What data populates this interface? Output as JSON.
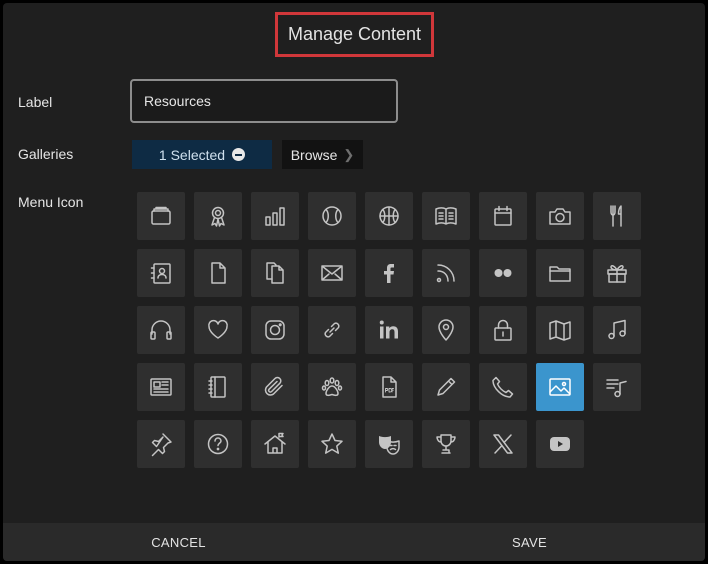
{
  "dialog": {
    "title": "Manage Content"
  },
  "fields": {
    "label": {
      "label": "Label",
      "value": "Resources"
    },
    "galleries": {
      "label": "Galleries",
      "selected_label": "1 Selected",
      "browse_label": "Browse"
    },
    "menu_icon": {
      "label": "Menu Icon"
    }
  },
  "icons": [
    [
      "wallet",
      "award",
      "bar-chart",
      "baseball",
      "basketball",
      "book",
      "calendar",
      "camera",
      "cutlery"
    ],
    [
      "contact-card",
      "document",
      "documents",
      "mail",
      "facebook",
      "rss",
      "flickr",
      "folder",
      "gift"
    ],
    [
      "headphones",
      "heart",
      "instagram",
      "link",
      "linkedin",
      "map-pin",
      "lock",
      "map",
      "music"
    ],
    [
      "newspaper",
      "notebook",
      "paperclip",
      "paw",
      "pdf",
      "pencil",
      "phone",
      "image",
      "playlist"
    ],
    [
      "pushpin",
      "question",
      "house-flag",
      "star",
      "theater-masks",
      "trophy",
      "x-logo",
      "youtube"
    ]
  ],
  "selected_icon": "image",
  "colors": {
    "accent": "#3b95cd",
    "highlight_border": "#d0373a",
    "selected_pill": "#0e2b44"
  },
  "footer": {
    "cancel_label": "CANCEL",
    "save_label": "SAVE"
  }
}
